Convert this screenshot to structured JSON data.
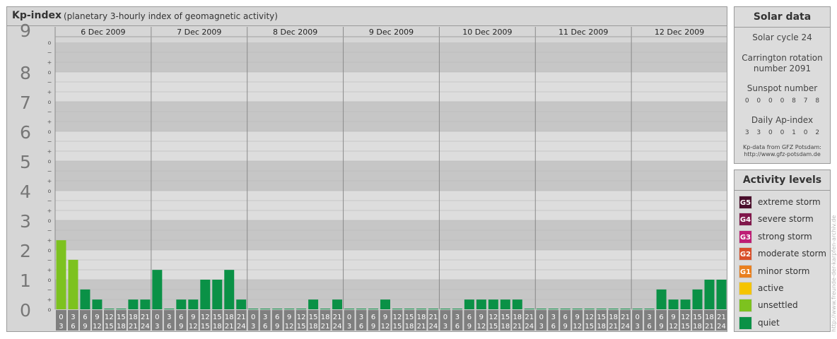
{
  "header": {
    "title": "Kp-index",
    "subtitle": "(planetary 3-hourly index of geomagnetic activity)"
  },
  "chart_data": {
    "type": "bar",
    "title": "Kp-index",
    "subtitle": "(planetary 3-hourly index of geomagnetic activity)",
    "ylim": [
      0,
      9
    ],
    "y_ticks": [
      "0",
      "1",
      "2",
      "3",
      "4",
      "5",
      "6",
      "7",
      "8",
      "9"
    ],
    "minor_tick_labels": [
      "o",
      "+",
      "−"
    ],
    "days": [
      "6 Dec 2009",
      "7 Dec 2009",
      "8 Dec 2009",
      "9 Dec 2009",
      "10 Dec 2009",
      "11 Dec 2009",
      "12 Dec 2009"
    ],
    "interval_top": [
      "0",
      "3",
      "6",
      "9",
      "12",
      "15",
      "18",
      "21"
    ],
    "interval_bottom": [
      "3",
      "6",
      "9",
      "12",
      "15",
      "18",
      "21",
      "24"
    ],
    "values": [
      [
        2.33,
        1.67,
        0.67,
        0.33,
        0,
        0,
        0.33,
        0.33
      ],
      [
        1.33,
        0,
        0.33,
        0.33,
        1.0,
        1.0,
        1.33,
        0.33
      ],
      [
        0,
        0,
        0,
        0,
        0,
        0.33,
        0,
        0.33
      ],
      [
        0,
        0,
        0,
        0.33,
        0,
        0,
        0,
        0
      ],
      [
        0,
        0,
        0.33,
        0.33,
        0.33,
        0.33,
        0.33,
        0
      ],
      [
        0,
        0,
        0,
        0,
        0,
        0,
        0,
        0
      ],
      [
        0,
        0,
        0.67,
        0.33,
        0.33,
        0.67,
        1.0,
        1.0
      ]
    ],
    "colors": {
      "quiet": "#0a9146",
      "unsettled": "#7dc21f",
      "active": "#f5c400",
      "band_dark": "#c6c6c6",
      "band_light": "#dddddd",
      "gridline": "#b4b4b4",
      "label_bg": "#7f7f7f"
    },
    "grid": true
  },
  "solar": {
    "title": "Solar data",
    "cycle": "Solar cycle 24",
    "carrington_line1": "Carrington rotation",
    "carrington_line2": "number 2091",
    "sunspot_title": "Sunspot number",
    "sunspot_values": [
      "0",
      "0",
      "0",
      "0",
      "8",
      "7",
      "8"
    ],
    "ap_title": "Daily Ap-index",
    "ap_values": [
      "3",
      "3",
      "0",
      "0",
      "1",
      "0",
      "2"
    ],
    "source_line1": "Kp-data from GFZ Potsdam:",
    "source_line2": "http://www.gfz-potsdam.de"
  },
  "activity": {
    "title": "Activity levels",
    "levels": [
      {
        "code": "G5",
        "label": "extreme storm",
        "color": "#4a0f2c"
      },
      {
        "code": "G4",
        "label": "severe storm",
        "color": "#80174a"
      },
      {
        "code": "G3",
        "label": "strong storm",
        "color": "#be1e75"
      },
      {
        "code": "G2",
        "label": "moderate storm",
        "color": "#d94f2a"
      },
      {
        "code": "G1",
        "label": "minor storm",
        "color": "#e9801f"
      },
      {
        "code": "",
        "label": "active",
        "color": "#f5c400"
      },
      {
        "code": "",
        "label": "unsettled",
        "color": "#7dc21f"
      },
      {
        "code": "",
        "label": "quiet",
        "color": "#0a9146"
      }
    ]
  },
  "watermark": "http://www.freunde-der-karpfen-archiv.de"
}
